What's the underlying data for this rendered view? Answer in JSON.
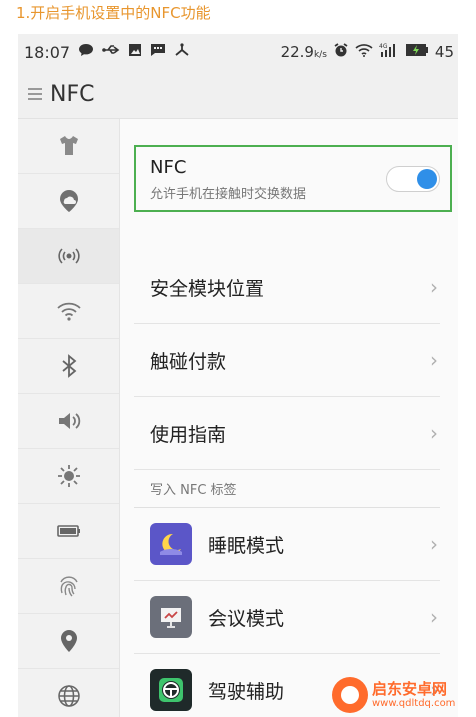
{
  "caption": "1.开启手机设置中的NFC功能",
  "statusbar": {
    "time": "18:07",
    "net_speed": "22.9",
    "net_unit": "k/s",
    "signal": "4G",
    "battery": "45"
  },
  "header": {
    "title": "NFC"
  },
  "nfc": {
    "title": "NFC",
    "subtitle": "允许手机在接触时交换数据",
    "enabled": true
  },
  "settings_rows": [
    {
      "label": "安全模块位置"
    },
    {
      "label": "触碰付款"
    },
    {
      "label": "使用指南"
    }
  ],
  "section_header": "写入 NFC 标签",
  "apps": [
    {
      "label": "睡眠模式",
      "icon": "moon-icon",
      "color": "#5b56c8"
    },
    {
      "label": "会议模式",
      "icon": "presentation-icon",
      "color": "#6b6f7a"
    },
    {
      "label": "驾驶辅助",
      "icon": "steering-wheel-icon",
      "color": "#1f2a2a"
    }
  ],
  "watermark": {
    "cn": "启东安卓网",
    "url": "www.qdltdq.com"
  },
  "colors": {
    "accent": "#2f8fe8",
    "highlight": "#4caf50",
    "caption": "#e8962e"
  }
}
